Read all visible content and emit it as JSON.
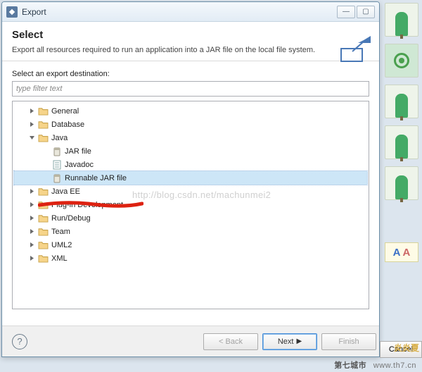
{
  "window": {
    "title": "Export"
  },
  "header": {
    "heading": "Select",
    "description": "Export all resources required to run an application into a JAR file on the local file system."
  },
  "body": {
    "destination_label": "Select an export destination:",
    "filter_placeholder": "type filter text"
  },
  "tree": {
    "items": [
      {
        "label": "General",
        "type": "folder",
        "depth": 1,
        "exp": "collapsed"
      },
      {
        "label": "Database",
        "type": "folder",
        "depth": 1,
        "exp": "collapsed"
      },
      {
        "label": "Java",
        "type": "folder",
        "depth": 1,
        "exp": "expanded"
      },
      {
        "label": "JAR file",
        "type": "jar",
        "depth": 2,
        "exp": "none"
      },
      {
        "label": "Javadoc",
        "type": "doc",
        "depth": 2,
        "exp": "none"
      },
      {
        "label": "Runnable JAR file",
        "type": "jar",
        "depth": 2,
        "exp": "none",
        "selected": true
      },
      {
        "label": "Java EE",
        "type": "folder",
        "depth": 1,
        "exp": "collapsed"
      },
      {
        "label": "Plug-in Development",
        "type": "folder",
        "depth": 1,
        "exp": "collapsed"
      },
      {
        "label": "Run/Debug",
        "type": "folder",
        "depth": 1,
        "exp": "collapsed"
      },
      {
        "label": "Team",
        "type": "folder",
        "depth": 1,
        "exp": "collapsed"
      },
      {
        "label": "UML2",
        "type": "folder",
        "depth": 1,
        "exp": "collapsed"
      },
      {
        "label": "XML",
        "type": "folder",
        "depth": 1,
        "exp": "collapsed"
      }
    ]
  },
  "watermark": "http://blog.csdn.net/machunmei2",
  "buttons": {
    "back": "< Back",
    "next": "Next",
    "finish": "Finish",
    "cancel": "Cancel",
    "help": "?"
  },
  "footer": {
    "site_cn": "第七城市",
    "site_en": "www.th7.cn"
  },
  "sidebar": {
    "hot_label": "炎炎夏"
  }
}
